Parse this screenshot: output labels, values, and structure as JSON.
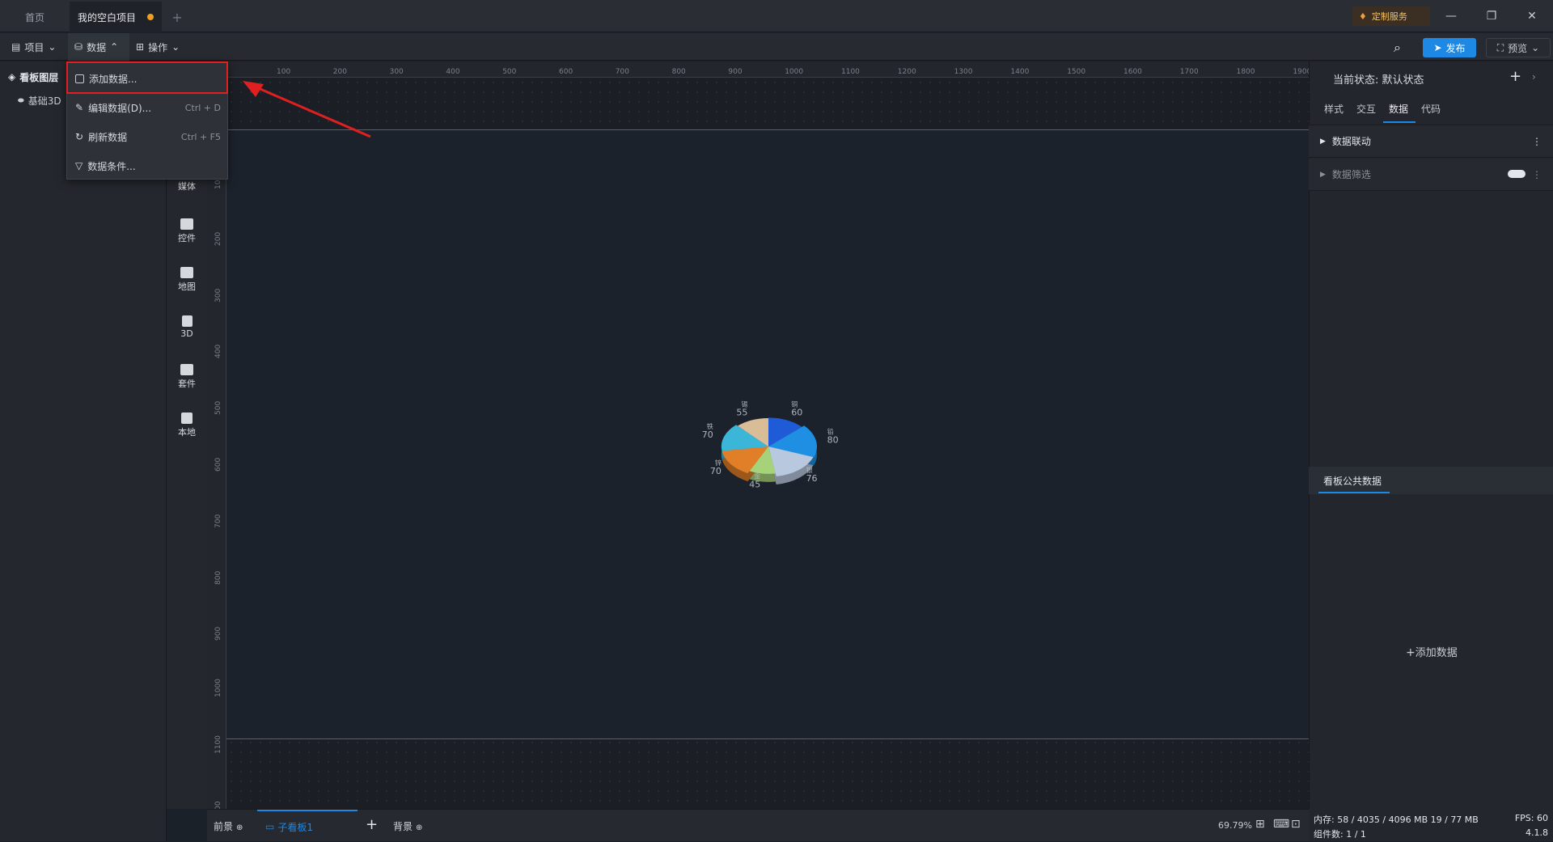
{
  "titlebar": {
    "tabs": [
      {
        "label": "首页"
      },
      {
        "label": "我的空白项目",
        "modified": true
      }
    ],
    "add_tab": "+",
    "custom_service": "定制服务",
    "minimize": "—",
    "restore": "❐",
    "close": "✕"
  },
  "menubar": {
    "project": "项目",
    "data": "数据",
    "operate": "操作",
    "publish": "发布",
    "preview": "预览"
  },
  "data_menu": {
    "items": [
      {
        "label": "添加数据...",
        "shortcut": ""
      },
      {
        "label": "编辑数据(D)...",
        "shortcut": "Ctrl + D"
      },
      {
        "label": "刷新数据",
        "shortcut": "Ctrl + F5"
      },
      {
        "label": "数据条件...",
        "shortcut": ""
      }
    ]
  },
  "left_panel": {
    "layers_title": "看板图层",
    "layer_item": "基础3D"
  },
  "icon_bar": [
    {
      "label": "媒体",
      "icon": "media-icon"
    },
    {
      "label": "控件",
      "icon": "control-icon"
    },
    {
      "label": "地图",
      "icon": "map-icon"
    },
    {
      "label": "3D",
      "icon": "cube-icon"
    },
    {
      "label": "套件",
      "icon": "kit-icon"
    },
    {
      "label": "本地",
      "icon": "puzzle-icon"
    }
  ],
  "ruler": {
    "top": [
      "100",
      "200",
      "300",
      "400",
      "500",
      "600",
      "700",
      "800",
      "900",
      "1000",
      "1100",
      "1200",
      "1300",
      "1400",
      "1500",
      "1600",
      "1700",
      "1800",
      "1900"
    ],
    "left": [
      "100",
      "200",
      "300",
      "400",
      "500",
      "600",
      "700",
      "800",
      "900",
      "1000",
      "1100",
      "00"
    ]
  },
  "right_panel": {
    "state_label": "当前状态:",
    "state_value": "默认状态",
    "tabs": [
      "样式",
      "交互",
      "数据",
      "代码"
    ],
    "active_tab": "数据",
    "sections": [
      {
        "label": "数据联动"
      },
      {
        "label": "数据筛选"
      }
    ],
    "public_data": "看板公共数据",
    "add_data": "添加数据"
  },
  "bottom_bar": {
    "foreground": "前景",
    "sub_board": "子看板1",
    "background": "背景",
    "zoom": "69.79%"
  },
  "status": {
    "memory": "内存:  58 / 4035 / 4096 MB  19 / 77 MB",
    "fps": "FPS:  60",
    "components": "组件数: 1 / 1",
    "version": "4.1.8"
  },
  "colors": {
    "accent": "#1e88e5",
    "highlight_border": "#e02020",
    "modified_dot": "#f0a020"
  },
  "chart_data": {
    "type": "pie",
    "categories": [
      "铜",
      "铅",
      "银",
      "金",
      "锌",
      "铁",
      "锡"
    ],
    "values": [
      60,
      80,
      76,
      45,
      70,
      70,
      55
    ],
    "colors": [
      "#1f5bd6",
      "#1f8fe3",
      "#b8c8de",
      "#a6d27a",
      "#e07f28",
      "#3bb6d8",
      "#d9bd96"
    ]
  }
}
